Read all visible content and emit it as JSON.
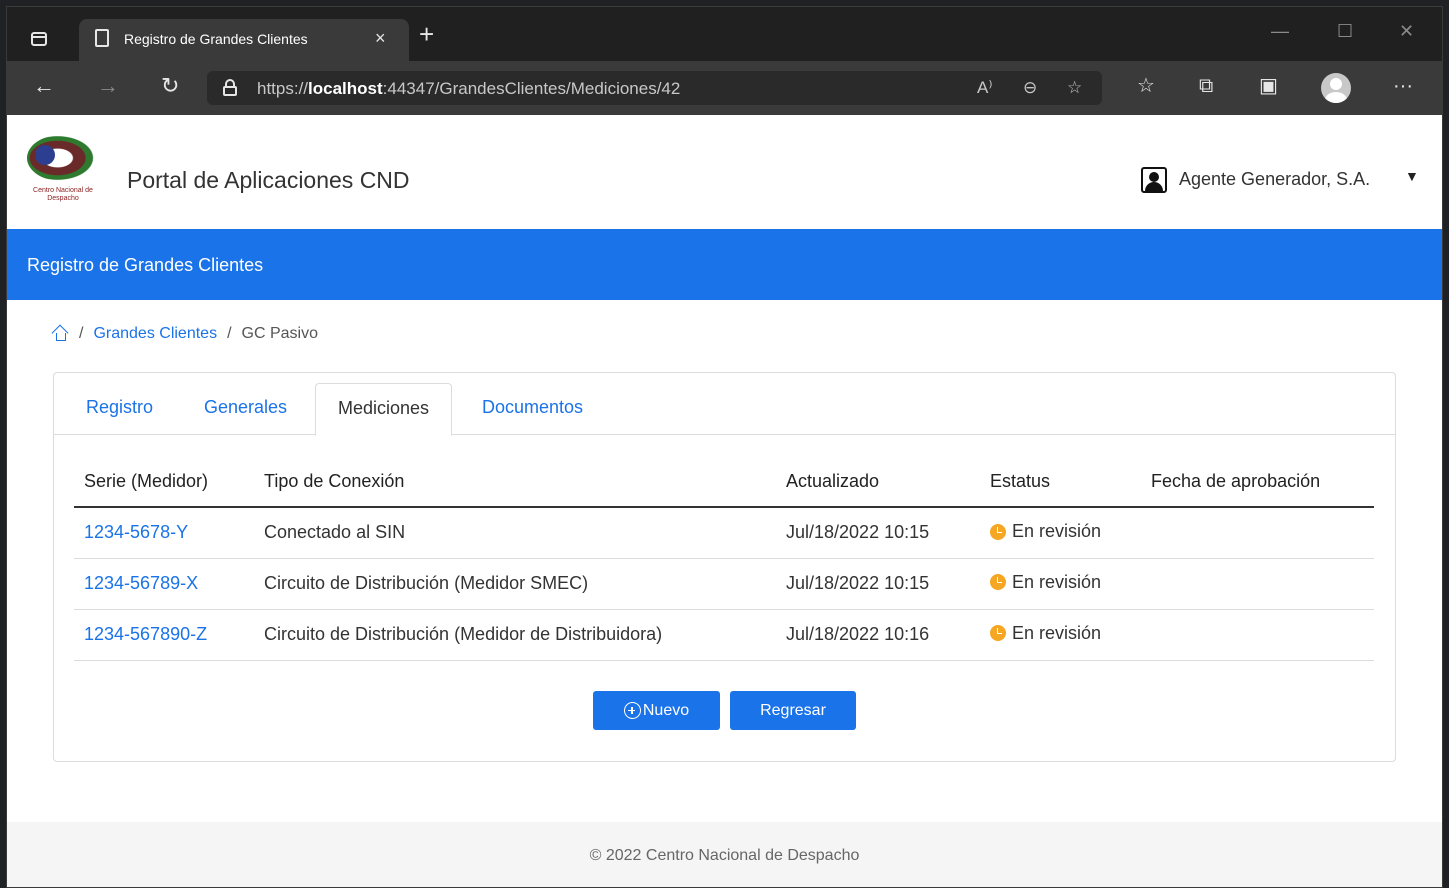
{
  "browser": {
    "tab_title": "Registro de Grandes Clientes",
    "tab_close": "×",
    "new_tab": "+",
    "url_prefix": "https://",
    "url_host": "localhost",
    "url_rest": ":44347/GrandesClientes/Mediciones/42",
    "window_controls": {
      "minimize": "—",
      "maximize": "☐",
      "close": "✕"
    },
    "nav": {
      "back": "←",
      "forward": "→",
      "refresh": "↻"
    },
    "toolbar_icons": [
      "read-aloud-icon",
      "zoom-out-icon",
      "add-favorite-icon",
      "favorites-icon",
      "collections-icon",
      "ie-mode-icon",
      "profile-icon",
      "more-icon"
    ]
  },
  "app": {
    "title": "Portal de Aplicaciones CND",
    "logo_text": "Centro Nacional de Despacho",
    "user": "Agente Generador, S.A.",
    "section_title": "Registro de Grandes Clientes"
  },
  "breadcrumb": {
    "link": "Grandes Clientes",
    "current": "GC Pasivo",
    "separator": "/"
  },
  "tabs": [
    {
      "label": "Registro",
      "active": false
    },
    {
      "label": "Generales",
      "active": false
    },
    {
      "label": "Mediciones",
      "active": true
    },
    {
      "label": "Documentos",
      "active": false
    }
  ],
  "table": {
    "headers": [
      "Serie (Medidor)",
      "Tipo de Conexión",
      "Actualizado",
      "Estatus",
      "Fecha de aprobación"
    ],
    "rows": [
      {
        "serie": "1234-5678-Y",
        "tipo": "Conectado al SIN",
        "actualizado": "Jul/18/2022 10:15",
        "estatus": "En revisión",
        "fecha": ""
      },
      {
        "serie": "1234-56789-X",
        "tipo": "Circuito de Distribución (Medidor SMEC)",
        "actualizado": "Jul/18/2022 10:15",
        "estatus": "En revisión",
        "fecha": ""
      },
      {
        "serie": "1234-567890-Z",
        "tipo": "Circuito de Distribución (Medidor de Distribuidora)",
        "actualizado": "Jul/18/2022 10:16",
        "estatus": "En revisión",
        "fecha": ""
      }
    ]
  },
  "buttons": {
    "new": "Nuevo",
    "back": "Regresar"
  },
  "footer": "© 2022 Centro Nacional de Despacho",
  "colors": {
    "accent": "#1a73e8",
    "status_pending": "#f5a623"
  }
}
